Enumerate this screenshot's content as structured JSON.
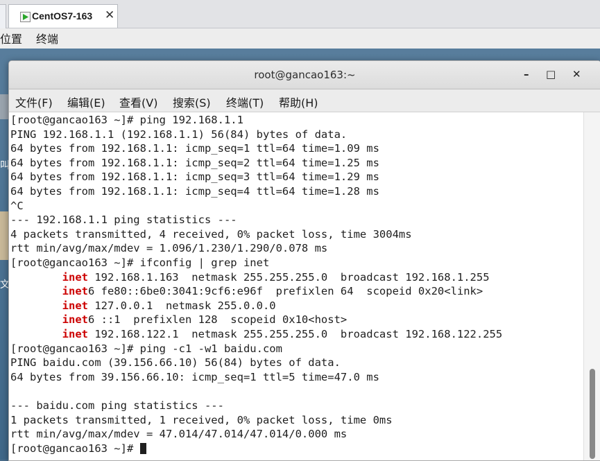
{
  "vm_tab": {
    "title": "CentOS7-163",
    "close": "✕"
  },
  "desktop_bar": {
    "items": [
      "位置",
      "终端"
    ]
  },
  "desktop": {
    "text1": "叫",
    "text2": "文"
  },
  "window": {
    "title": "root@gancao163:~",
    "controls": {
      "minimize": "–",
      "maximize": "□",
      "close": "✕"
    }
  },
  "menu": [
    "文件(F)",
    "编辑(E)",
    "查看(V)",
    "搜索(S)",
    "终端(T)",
    "帮助(H)"
  ],
  "terminal": {
    "lines": [
      {
        "text": "[root@gancao163 ~]# ping 192.168.1.1"
      },
      {
        "text": "PING 192.168.1.1 (192.168.1.1) 56(84) bytes of data."
      },
      {
        "text": "64 bytes from 192.168.1.1: icmp_seq=1 ttl=64 time=1.09 ms"
      },
      {
        "text": "64 bytes from 192.168.1.1: icmp_seq=2 ttl=64 time=1.25 ms"
      },
      {
        "text": "64 bytes from 192.168.1.1: icmp_seq=3 ttl=64 time=1.29 ms"
      },
      {
        "text": "64 bytes from 192.168.1.1: icmp_seq=4 ttl=64 time=1.28 ms"
      },
      {
        "text": "^C"
      },
      {
        "text": "--- 192.168.1.1 ping statistics ---"
      },
      {
        "text": "4 packets transmitted, 4 received, 0% packet loss, time 3004ms"
      },
      {
        "text": "rtt min/avg/max/mdev = 1.096/1.230/1.290/0.078 ms"
      },
      {
        "text": "[root@gancao163 ~]# ifconfig | grep inet"
      },
      {
        "indent": "        ",
        "kw": "inet",
        "text": " 192.168.1.163  netmask 255.255.255.0  broadcast 192.168.1.255"
      },
      {
        "indent": "        ",
        "kw": "inet",
        "text": "6 fe80::6be0:3041:9cf6:e96f  prefixlen 64  scopeid 0x20<link>"
      },
      {
        "indent": "        ",
        "kw": "inet",
        "text": " 127.0.0.1  netmask 255.0.0.0"
      },
      {
        "indent": "        ",
        "kw": "inet",
        "text": "6 ::1  prefixlen 128  scopeid 0x10<host>"
      },
      {
        "indent": "        ",
        "kw": "inet",
        "text": " 192.168.122.1  netmask 255.255.255.0  broadcast 192.168.122.255"
      },
      {
        "text": "[root@gancao163 ~]# ping -c1 -w1 baidu.com"
      },
      {
        "text": "PING baidu.com (39.156.66.10) 56(84) bytes of data."
      },
      {
        "text": "64 bytes from 39.156.66.10: icmp_seq=1 ttl=5 time=47.0 ms"
      },
      {
        "text": ""
      },
      {
        "text": "--- baidu.com ping statistics ---"
      },
      {
        "text": "1 packets transmitted, 1 received, 0% packet loss, time 0ms"
      },
      {
        "text": "rtt min/avg/max/mdev = 47.014/47.014/47.014/0.000 ms"
      },
      {
        "text": "[root@gancao163 ~]# ",
        "cursor": true
      }
    ]
  },
  "colors": {
    "keyword": "#cc0000",
    "text": "#1f1f1f"
  }
}
